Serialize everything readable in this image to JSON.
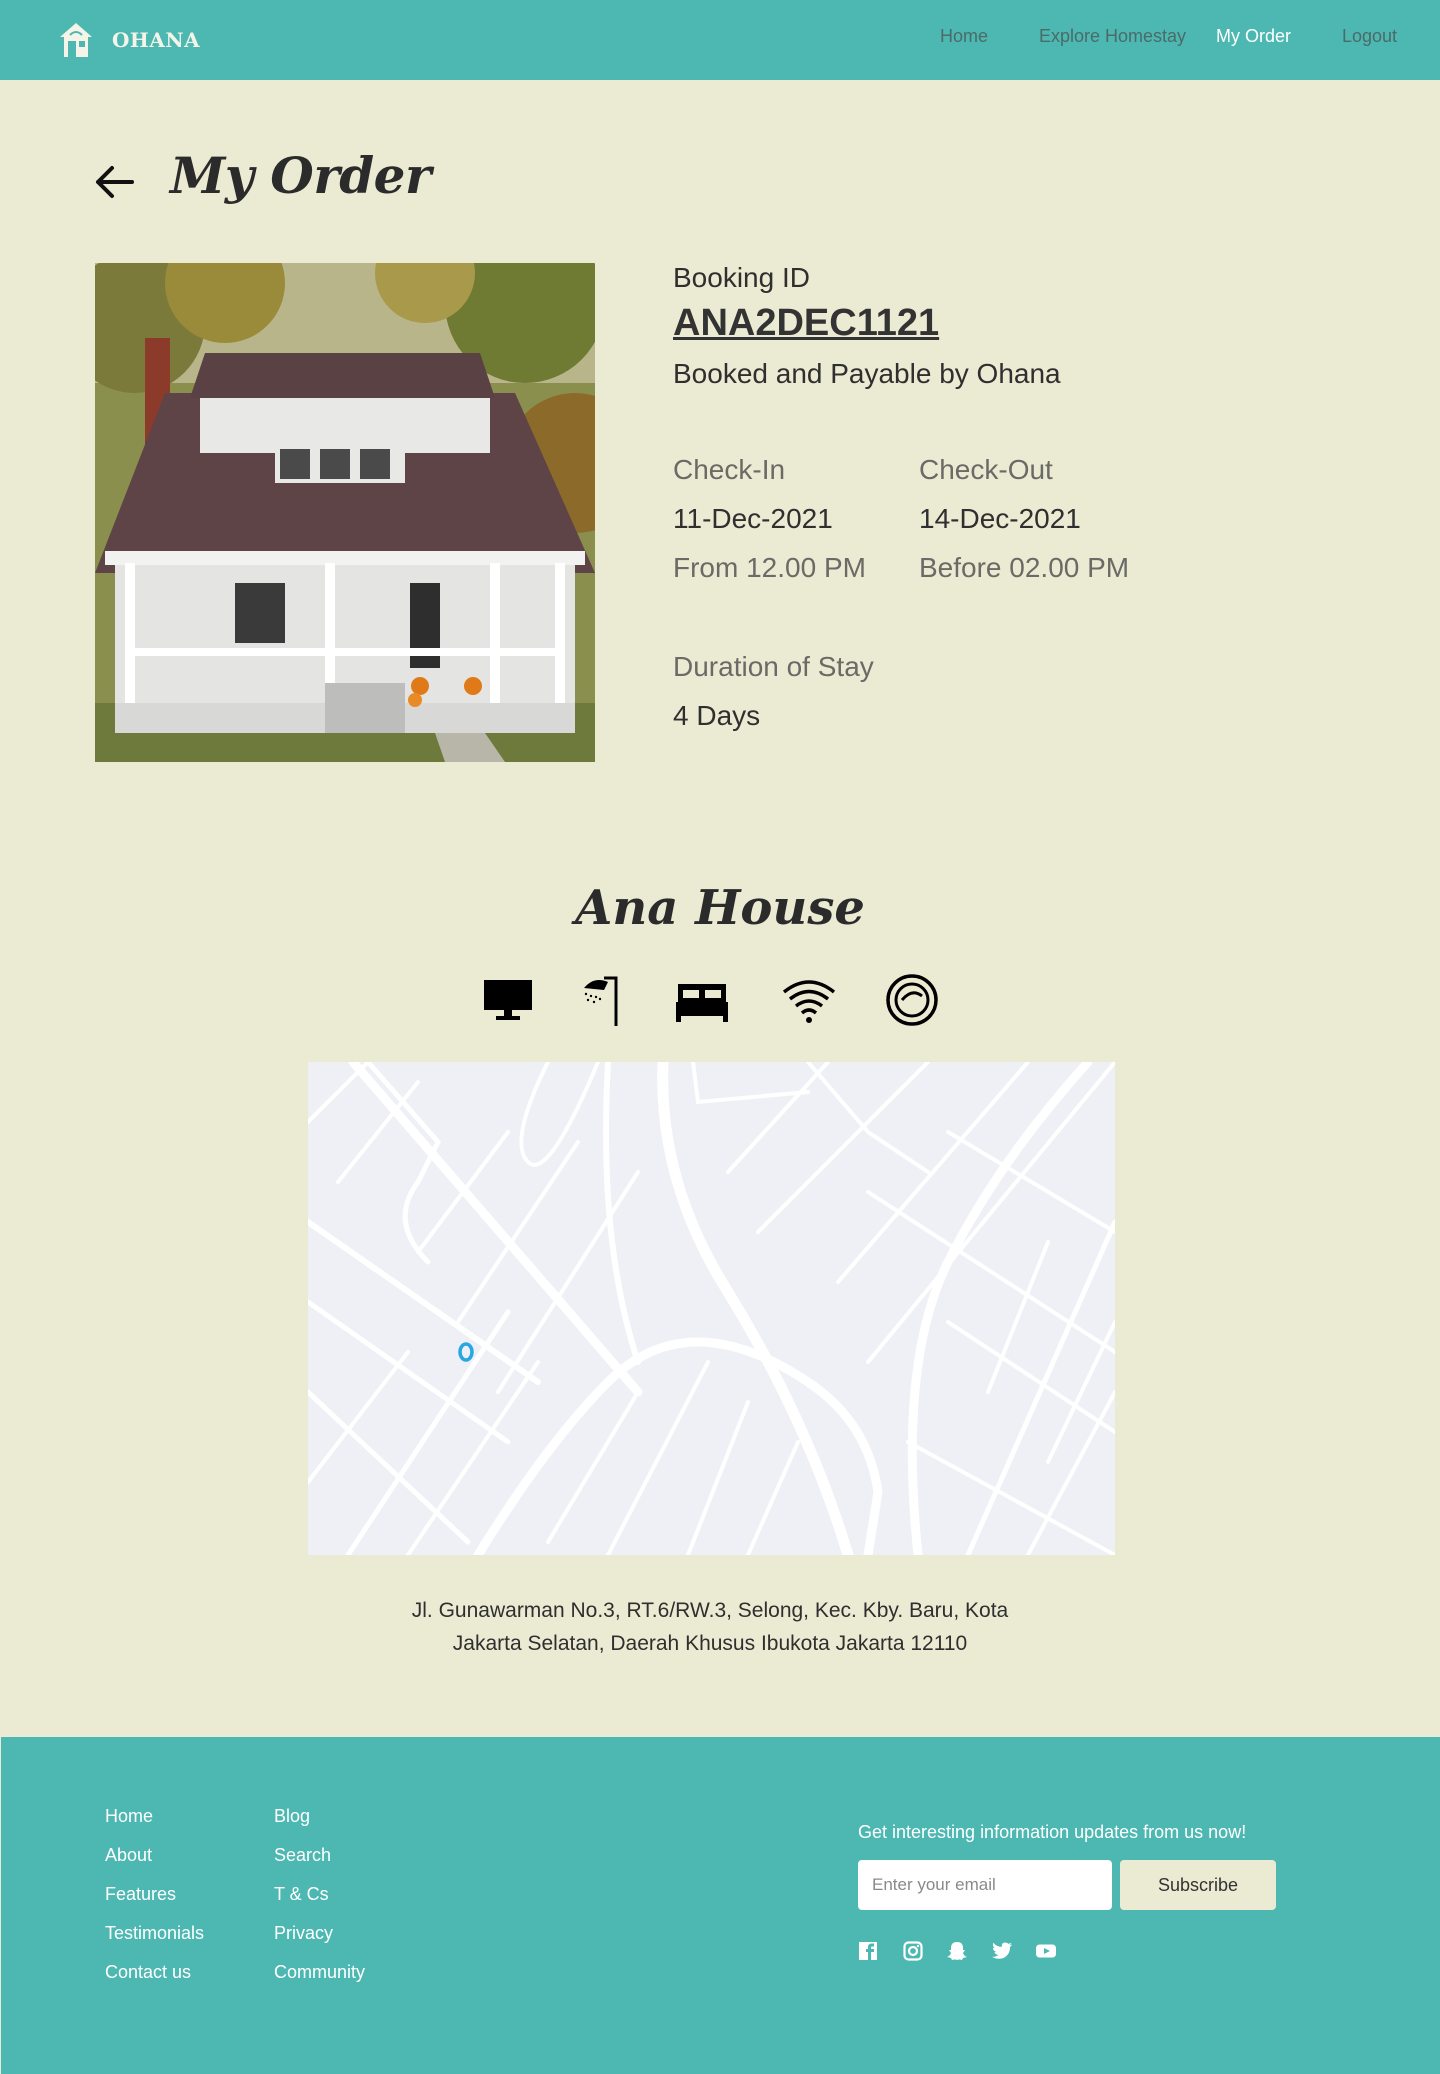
{
  "header": {
    "brand": "OHANA",
    "brand_icon": "house-icon",
    "nav": [
      "Home",
      "Explore Homestay",
      "My Order",
      "Logout"
    ],
    "active": "My Order",
    "nav_color": "#4a6b69",
    "bg_color": "#4db8b2"
  },
  "page": {
    "title": "My Order",
    "back_icon": "arrow-left-icon",
    "bg_color": "#ebebd3"
  },
  "booking": {
    "id_label": "Booking ID",
    "id": "ANA2DEC1121",
    "payable": "Booked and Payable by Ohana",
    "checkin_label": "Check-In",
    "checkin_date": "11-Dec-2021",
    "checkin_time": "From 12.00 PM",
    "checkout_label": "Check-Out",
    "checkout_date": "14-Dec-2021",
    "checkout_time": "Before 02.00 PM",
    "duration_label": "Duration of Stay",
    "duration": "4 Days"
  },
  "property": {
    "name": "Ana House",
    "amenities": [
      "tv-icon",
      "shower-icon",
      "bed-icon",
      "wifi-icon",
      "pool-icon"
    ],
    "address_line1": "Jl. Gunawarman No.3, RT.6/RW.3, Selong, Kec. Kby. Baru, Kota",
    "address_line2": "Jakarta Selatan, Daerah Khusus Ibukota Jakarta 12110",
    "map_marker": "map-pin-icon"
  },
  "footer": {
    "col1": [
      "Home",
      "About",
      "Features",
      "Testimonials",
      "Contact us"
    ],
    "col2": [
      "Blog",
      "Search",
      "T & Cs",
      "Privacy",
      "Community"
    ],
    "newsletter_text": "Get interesting information updates from us now!",
    "email_placeholder": "Enter your email",
    "subscribe_label": "Subscribe",
    "social": [
      "facebook-icon",
      "instagram-icon",
      "snapchat-icon",
      "twitter-icon",
      "youtube-icon"
    ]
  }
}
